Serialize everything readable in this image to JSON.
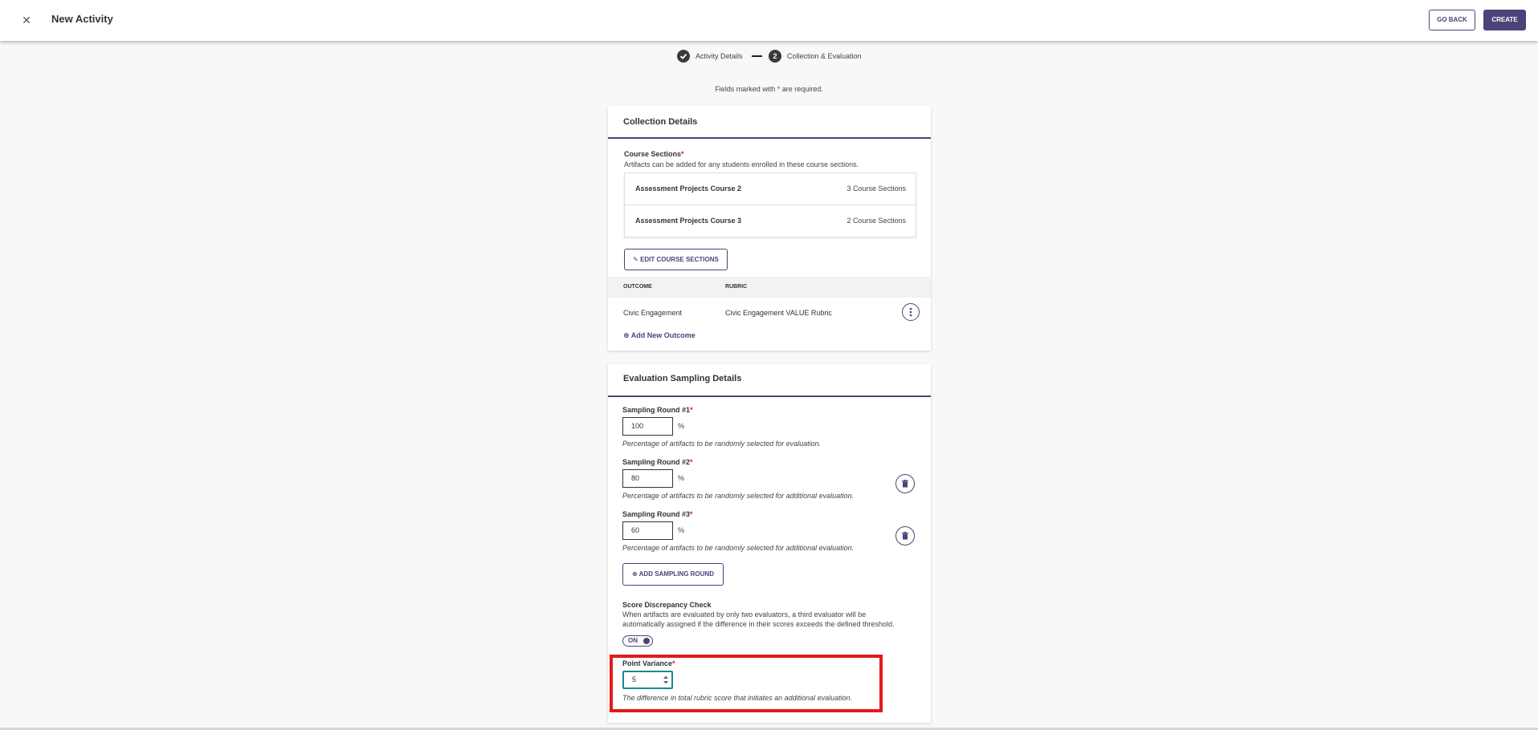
{
  "header": {
    "close_icon": "close-icon",
    "title": "New Activity",
    "go_back_label": "GO BACK",
    "create_label": "CREATE"
  },
  "stepper": {
    "step1_label": "Activity Details",
    "step1_state": "complete",
    "step2_number": "2",
    "step2_label": "Collection & Evaluation"
  },
  "required_note": {
    "before": "Fields marked with",
    "star": "*",
    "after": "are required."
  },
  "collection": {
    "title": "Collection Details",
    "course_sections_label": "Course Sections",
    "course_sections_desc": "Artifacts can be added for any students enrolled in these course sections.",
    "courses": [
      {
        "name": "Assessment Projects Course 2",
        "count": "3 Course Sections"
      },
      {
        "name": "Assessment Projects Course 3",
        "count": "2 Course Sections"
      }
    ],
    "edit_button_label": "EDIT COURSE SECTIONS",
    "table": {
      "col_outcome": "OUTCOME",
      "col_rubric": "RUBRIC",
      "rows": [
        {
          "outcome": "Civic Engagement",
          "rubric": "Civic Engagement VALUE Rubric"
        }
      ]
    },
    "add_outcome_label": "Add New Outcome"
  },
  "sampling": {
    "title": "Evaluation Sampling Details",
    "rounds": [
      {
        "label": "Sampling Round #1",
        "value": "100",
        "unit": "%",
        "hint": "Percentage of artifacts to be randomly selected for evaluation."
      },
      {
        "label": "Sampling Round #2",
        "value": "80",
        "unit": "%",
        "hint": "Percentage of artifacts to be randomly selected for additional evaluation."
      },
      {
        "label": "Sampling Round #3",
        "value": "60",
        "unit": "%",
        "hint": "Percentage of artifacts to be randomly selected for additional evaluation."
      }
    ],
    "add_round_label": "ADD SAMPLING ROUND",
    "discrepancy_label": "Score Discrepancy Check",
    "discrepancy_desc_line1": "When artifacts are evaluated by only two evaluators, a third evaluator will be",
    "discrepancy_desc_line2": "automatically assigned if the difference in their scores exceeds the defined threshold.",
    "toggle_label": "ON",
    "point_variance_label": "Point Variance",
    "point_variance_value": "5",
    "point_variance_hint": "The difference in total rubric score that initiates an additional evaluation."
  },
  "colors": {
    "accent": "#4a4478",
    "highlight": "#e11b1b",
    "focus": "#1a8a90",
    "required": "#c62828"
  }
}
